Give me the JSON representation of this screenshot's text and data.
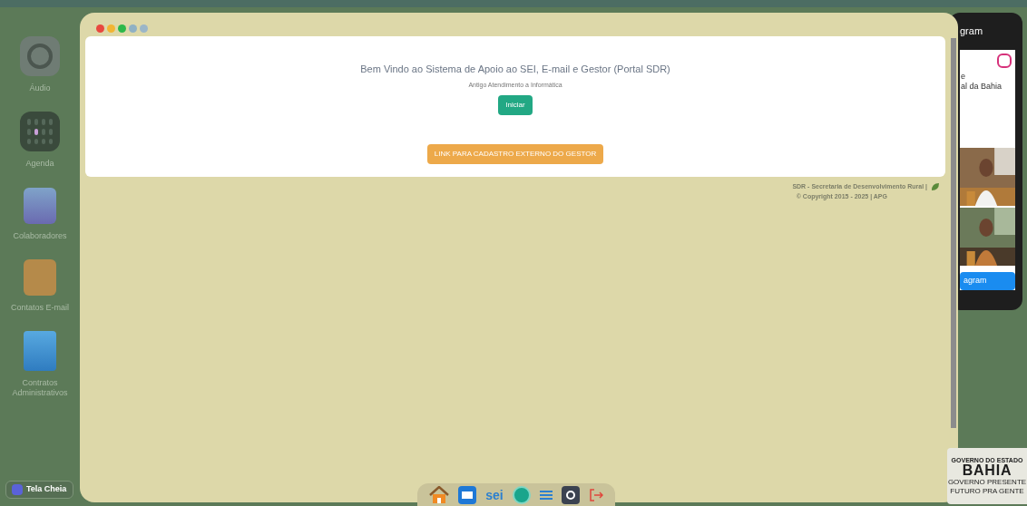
{
  "desktop_icons": [
    {
      "label": "Áudio",
      "kind": "audio"
    },
    {
      "label": "Agenda",
      "kind": "agenda"
    },
    {
      "label": "Colaboradores",
      "kind": "people"
    },
    {
      "label": "Contatos E-mail",
      "kind": "contacts"
    },
    {
      "label": "Contratos Administrativos",
      "kind": "document"
    }
  ],
  "fullscreen_button": "Tela Cheia",
  "window": {
    "controls": [
      {
        "color": "#e8483f"
      },
      {
        "color": "#f2b533"
      },
      {
        "color": "#2db84a"
      },
      {
        "color": "#8fb1c4"
      },
      {
        "color": "#9bb6c8"
      }
    ],
    "card": {
      "title": "Bem Vindo ao Sistema de Apoio ao SEI, E-mail e Gestor (Portal SDR)",
      "subtitle": "Antigo Atendimento a Informática",
      "start_button": "Iniciar",
      "external_link_button": "LINK PARA CADASTRO EXTERNO DO GESTOR"
    },
    "footer": [
      "SDR - Secretaria de Desenvolvimento Rural |",
      "© Copyright 2015 - 2025 | APG"
    ]
  },
  "instagram_panel": {
    "title": "gram",
    "lines": [
      "e",
      "al da Bahia"
    ],
    "button": "agram"
  },
  "dock": [
    {
      "kind": "home"
    },
    {
      "kind": "mail"
    },
    {
      "kind": "text",
      "label": "sei"
    },
    {
      "kind": "circle"
    },
    {
      "kind": "list"
    },
    {
      "kind": "key"
    },
    {
      "kind": "logout"
    }
  ],
  "logo": {
    "top": "GOVERNO DO ESTADO",
    "name": "BAHIA",
    "bottom": [
      "GOVERNO PRESENTE",
      "FUTURO PRA GENTE"
    ]
  }
}
